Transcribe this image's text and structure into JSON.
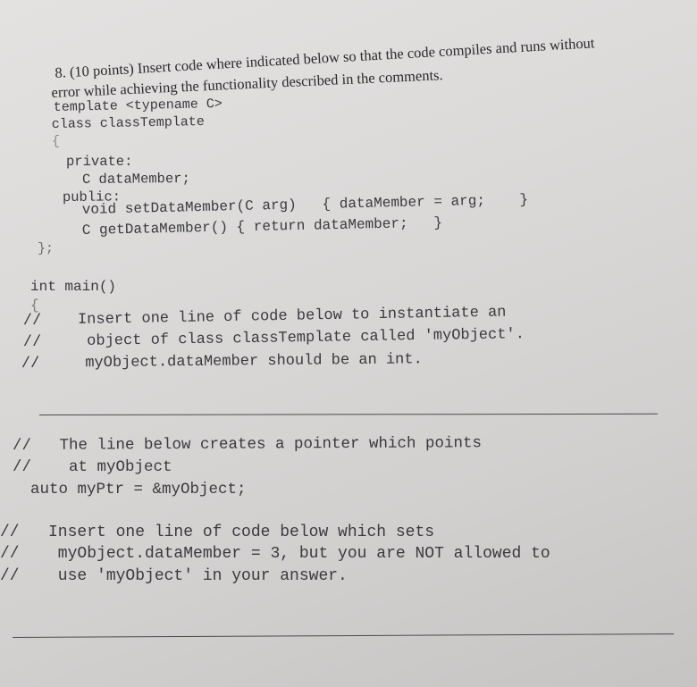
{
  "question": {
    "line1": "8. (10 points)  Insert code where indicated below so that the code compiles and runs without",
    "line2": "error while achieving the functionality described in the comments."
  },
  "code": {
    "template_line": "template <typename C>",
    "class_line": "class classTemplate",
    "open_brace": "{",
    "private_label": "private:",
    "data_member_decl": "C dataMember;",
    "public_label": "public:",
    "setter": "void setDataMember(C arg)   { dataMember = arg;    }",
    "getter": "C getDataMember() { return dataMember;   }",
    "close_class": "};",
    "main_sig": "int main()",
    "main_open": "{",
    "comment1": [
      "//    Insert one line of code below to instantiate an",
      "//     object of class classTemplate called 'myObject'.",
      "//     myObject.dataMember should be an int."
    ],
    "comment2": [
      "//   The line below creates a pointer which points",
      "//    at myObject"
    ],
    "pointer_line": "auto myPtr = &myObject;",
    "comment3": [
      "//   Insert one line of code below which sets",
      "//    myObject.dataMember = 3, but you are NOT allowed to",
      "//    use 'myObject' in your answer."
    ]
  },
  "answers": {
    "answer1": "",
    "answer2": ""
  }
}
